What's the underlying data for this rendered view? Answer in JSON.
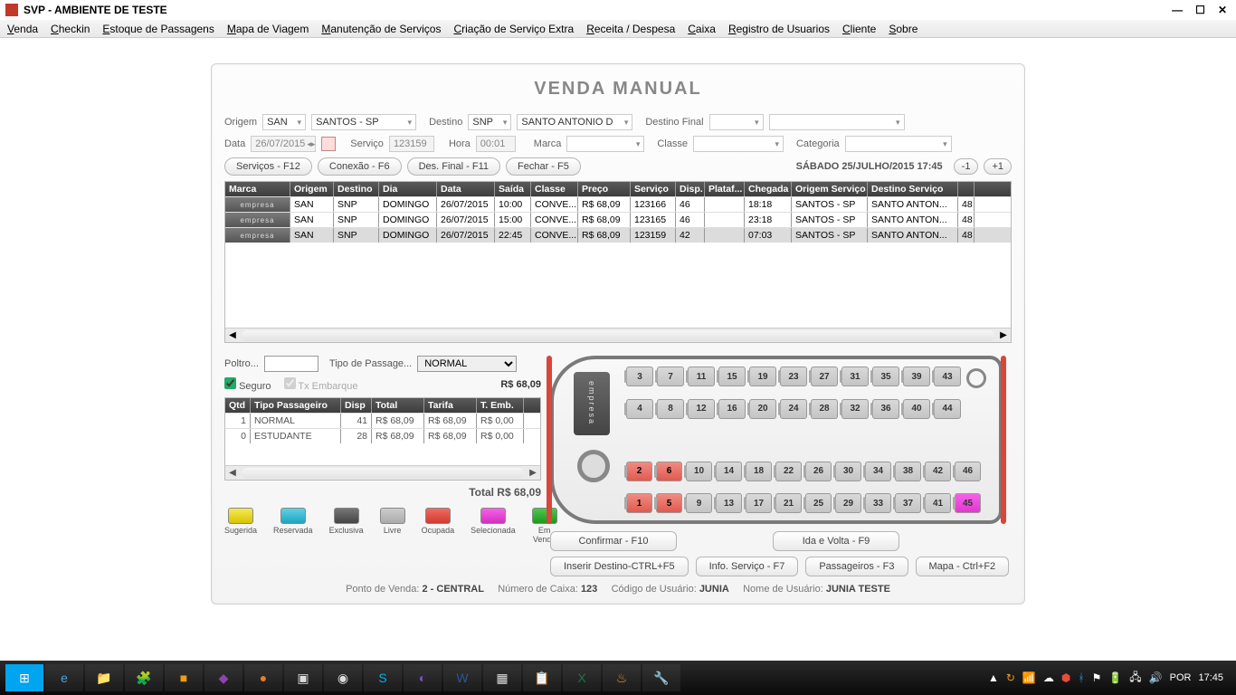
{
  "window": {
    "title": "SVP - AMBIENTE DE TESTE"
  },
  "menu": [
    "Venda",
    "Checkin",
    "Estoque de Passagens",
    "Mapa de Viagem",
    "Manutenção de Serviços",
    "Criação de Serviço Extra",
    "Receita / Despesa",
    "Caixa",
    "Registro de Usuarios",
    "Cliente",
    "Sobre"
  ],
  "page_title": "VENDA MANUAL",
  "search": {
    "origem_lbl": "Origem",
    "origem_code": "SAN",
    "origem_name": "SANTOS - SP",
    "destino_lbl": "Destino",
    "destino_code": "SNP",
    "destino_name": "SANTO ANTONIO D",
    "destino_final_lbl": "Destino Final",
    "destino_final": "",
    "data_lbl": "Data",
    "data": "26/07/2015",
    "servico_lbl": "Serviço",
    "servico": "123159",
    "hora_lbl": "Hora",
    "hora": "00:01",
    "marca_lbl": "Marca",
    "classe_lbl": "Classe",
    "categoria_lbl": "Categoria"
  },
  "buttons": {
    "servicos": "Serviços - F12",
    "conexao": "Conexão - F6",
    "desfinal": "Des. Final - F11",
    "fechar": "Fechar - F5",
    "minus": "-1",
    "plus": "+1"
  },
  "clock": "SÁBADO 25/JULHO/2015 17:45",
  "grid": {
    "headers": [
      "Marca",
      "Origem",
      "Destino",
      "Dia",
      "Data",
      "Saída",
      "Classe",
      "Preço",
      "Serviço",
      "Disp.",
      "Plataf...",
      "Chegada",
      "Origem Serviço",
      "Destino Serviço",
      ""
    ],
    "widths": [
      72,
      48,
      50,
      64,
      64,
      40,
      52,
      58,
      50,
      32,
      44,
      52,
      84,
      100,
      18
    ],
    "rows": [
      [
        "empresa",
        "SAN",
        "SNP",
        "DOMINGO",
        "26/07/2015",
        "10:00",
        "CONVE...",
        "R$ 68,09",
        "123166",
        "46",
        "",
        "18:18",
        "SANTOS - SP",
        "SANTO ANTON...",
        "48"
      ],
      [
        "empresa",
        "SAN",
        "SNP",
        "DOMINGO",
        "26/07/2015",
        "15:00",
        "CONVE...",
        "R$ 68,09",
        "123165",
        "46",
        "",
        "23:18",
        "SANTOS - SP",
        "SANTO ANTON...",
        "48"
      ],
      [
        "empresa",
        "SAN",
        "SNP",
        "DOMINGO",
        "26/07/2015",
        "22:45",
        "CONVE...",
        "R$ 68,09",
        "123159",
        "42",
        "",
        "07:03",
        "SANTOS - SP",
        "SANTO ANTON...",
        "48"
      ]
    ],
    "selected": 2
  },
  "form": {
    "poltrona_lbl": "Poltro...",
    "poltrona": "",
    "tipo_lbl": "Tipo de Passage...",
    "tipo": "NORMAL",
    "seguro_lbl": "Seguro",
    "tx_lbl": "Tx Embarque",
    "preco": "R$ 68,09"
  },
  "mini": {
    "headers": [
      "Qtd",
      "Tipo Passageiro",
      "Disp",
      "Total",
      "Tarifa",
      "T. Emb."
    ],
    "widths": [
      28,
      100,
      34,
      58,
      58,
      52
    ],
    "rows": [
      [
        "1",
        "NORMAL",
        "41",
        "R$ 68,09",
        "R$ 68,09",
        "R$ 0,00"
      ],
      [
        "0",
        "ESTUDANTE",
        "28",
        "R$ 68,09",
        "R$ 68,09",
        "R$ 0,00"
      ]
    ]
  },
  "total_lbl": "Total R$ 68,09",
  "seats": {
    "rows": [
      [
        3,
        7,
        11,
        15,
        19,
        23,
        27,
        31,
        35,
        39,
        43
      ],
      [
        4,
        8,
        12,
        16,
        20,
        24,
        28,
        32,
        36,
        40,
        44
      ],
      [
        2,
        6,
        10,
        14,
        18,
        22,
        26,
        30,
        34,
        38,
        42,
        46
      ],
      [
        1,
        5,
        9,
        13,
        17,
        21,
        25,
        29,
        33,
        37,
        41,
        45
      ]
    ],
    "red": [
      1,
      2,
      5,
      6
    ],
    "magenta": [
      45
    ],
    "brand": "empresa"
  },
  "actions": {
    "confirmar": "Confirmar - F10",
    "idavolta": "Ida e Volta - F9",
    "inserir": "Inserir Destino-CTRL+F5",
    "info": "Info. Serviço - F7",
    "pass": "Passageiros - F3",
    "mapa": "Mapa - Ctrl+F2"
  },
  "legend": [
    {
      "cls": "yellow",
      "txt": "Sugerida"
    },
    {
      "cls": "cyan",
      "txt": "Reservada"
    },
    {
      "cls": "dark",
      "txt": "Exclusiva"
    },
    {
      "cls": "gray",
      "txt": "Livre"
    },
    {
      "cls": "red",
      "txt": "Ocupada"
    },
    {
      "cls": "mag",
      "txt": "Selecionada"
    },
    {
      "cls": "green",
      "txt": "Em Venda"
    }
  ],
  "status": {
    "pv_lbl": "Ponto de Venda:",
    "pv": "2 - CENTRAL",
    "cx_lbl": "Número de Caixa:",
    "cx": "123",
    "cu_lbl": "Código de Usuário:",
    "cu": "JUNIA",
    "nu_lbl": "Nome de Usuário:",
    "nu": "JUNIA TESTE"
  },
  "tray": {
    "lang": "POR",
    "time": "17:45"
  }
}
